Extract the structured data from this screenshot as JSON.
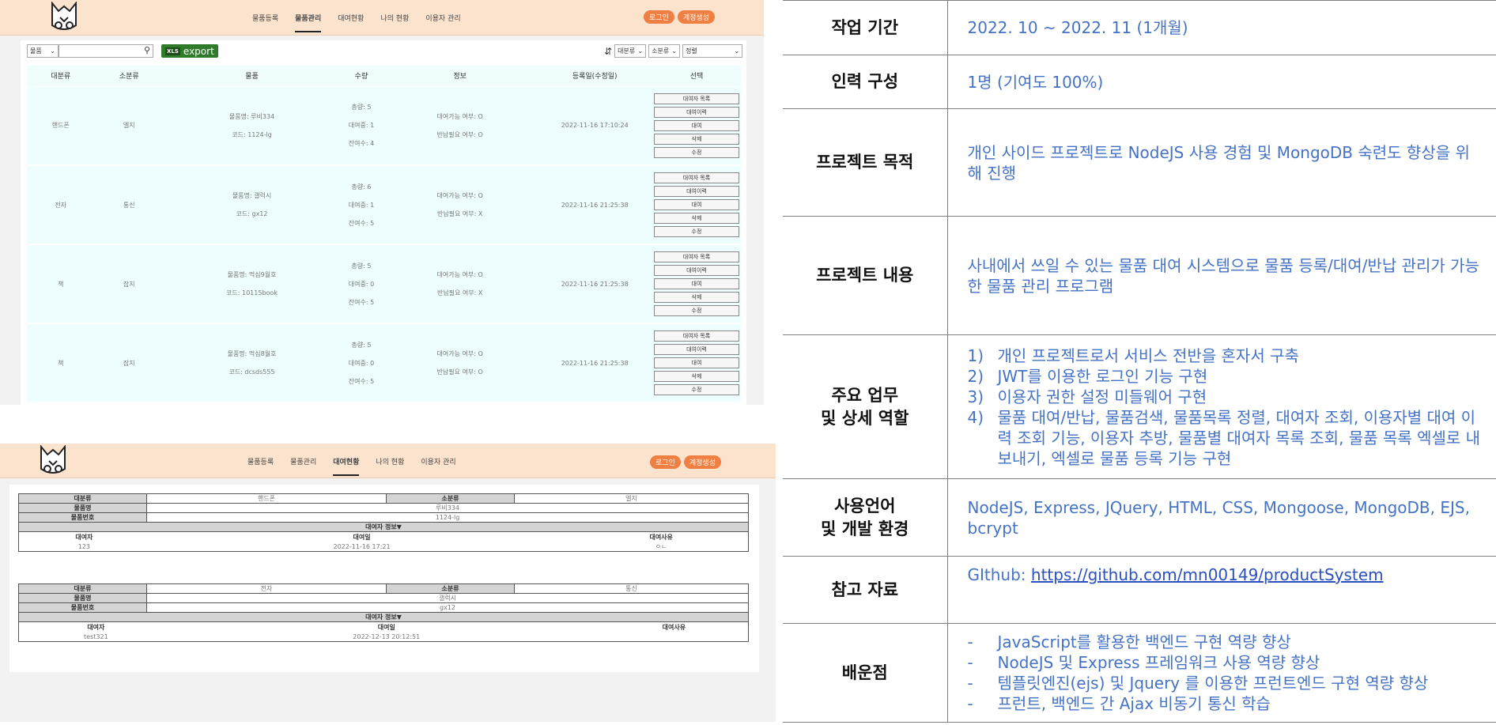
{
  "app": {
    "nav": [
      "물품등록",
      "물품관리",
      "대여현황",
      "나의 현황",
      "이용자 관리"
    ],
    "login_label": "로그인",
    "signup_label": "계정생성"
  },
  "screen1": {
    "active_tab": "물품관리",
    "search_category": "물품",
    "search_value": "",
    "export_label": "export",
    "xls_badge": "XLS",
    "filter_major": "대분류",
    "filter_minor": "소분류",
    "sort_label": "정렬",
    "columns": [
      "대분류",
      "소분류",
      "물품",
      "수량",
      "정보",
      "등록일(수정일)",
      "선택"
    ],
    "rows": [
      {
        "major": "핸드폰",
        "minor": "엘지",
        "name": "물품명: 루비334",
        "code": "코드: 1124-lg",
        "total": "총량: 5",
        "renting": "대여중: 1",
        "remain": "잔여수: 4",
        "rentable": "대여가능 여부: O",
        "returnable": "반납필요 여부: O",
        "date": "2022-11-16 17:10:24"
      },
      {
        "major": "전자",
        "minor": "통신",
        "name": "물품명: 갤럭시",
        "code": "코드: gx12",
        "total": "총량: 6",
        "renting": "대여중: 1",
        "remain": "잔여수: 5",
        "rentable": "대여가능 여부: O",
        "returnable": "반납필요 여부: X",
        "date": "2022-11-16 21:25:38"
      },
      {
        "major": "책",
        "minor": "잡지",
        "name": "물품명: 먹심9월호",
        "code": "코드: 10115book",
        "total": "총량: 5",
        "renting": "대여중: 0",
        "remain": "잔여수: 5",
        "rentable": "대여가능 여부: O",
        "returnable": "반납필요 여부: X",
        "date": "2022-11-16 21:25:38"
      },
      {
        "major": "책",
        "minor": "잡지",
        "name": "물품명: 먹심8월호",
        "code": "코드: dcsds555",
        "total": "총량: 5",
        "renting": "대여중: 0",
        "remain": "잔여수: 5",
        "rentable": "대여가능 여부: O",
        "returnable": "반납필요 여부: O",
        "date": "2022-11-16 21:25:38"
      }
    ],
    "row_buttons": [
      "대여자 목록",
      "대여이력",
      "대여",
      "삭제",
      "수정"
    ]
  },
  "screen2": {
    "active_tab": "대여현황",
    "labels": {
      "major": "대분류",
      "minor": "소분류",
      "name": "물품명",
      "code": "물품번호",
      "rent_info": "대여자 정보▼",
      "renter": "대여자",
      "rent_date": "대여일",
      "reason": "대여사유"
    },
    "records": [
      {
        "major": "핸드폰",
        "minor": "엘지",
        "name": "루비334",
        "code": "1124-lg",
        "renter": "123",
        "date": "2022-11-16 17:21",
        "reason": "ㅇㄴ"
      },
      {
        "major": "전자",
        "minor": "통신",
        "name": "갤럭시",
        "code": "gx12",
        "renter": "test321",
        "date": "2022-12-13 20:12:51",
        "reason": ""
      }
    ]
  },
  "summary": {
    "period": {
      "label": "작업 기간",
      "value": "2022. 10 ~ 2022. 11 (1개월)"
    },
    "team": {
      "label": "인력 구성",
      "value": "1명 (기여도 100%)"
    },
    "purpose": {
      "label": "프로젝트 목적",
      "value": "개인 사이드 프로젝트로 NodeJS 사용 경험 및 MongoDB 숙련도 향상을 위해 진행"
    },
    "content": {
      "label": "프로젝트 내용",
      "value": "사내에서 쓰일 수 있는 물품 대여 시스템으로 물품 등록/대여/반납 관리가 가능한 물품 관리 프로그램"
    },
    "duties": {
      "label_line1": "주요 업무",
      "label_line2": "및 상세 역할",
      "items": [
        {
          "n": "1)",
          "text": "개인 프로젝트로서 서비스 전반을 혼자서 구축"
        },
        {
          "n": "2)",
          "text": "JWT를 이용한 로그인 기능 구현"
        },
        {
          "n": "3)",
          "text": "이용자 권한 설정 미들웨어 구현"
        },
        {
          "n": "4)",
          "text": "물품 대여/반납, 물품검색, 물품목록 정렬, 대여자 조회, 이용자별 대여 이력 조회 기능, 이용자 추방, 물품별 대여자 목록 조회, 물품 목록 엑셀로 내보내기, 엑셀로 물품 등록 기능 구현"
        }
      ]
    },
    "stack": {
      "label_line1": "사용언어",
      "label_line2": "및 개발 환경",
      "value": "NodeJS, Express, JQuery, HTML, CSS, Mongoose, MongoDB, EJS, bcrypt"
    },
    "refs": {
      "label": "참고 자료",
      "prefix": "GIthub: ",
      "link": "https://github.com/mn00149/productSystem"
    },
    "learned": {
      "label": "배운점",
      "items": [
        {
          "n": "-",
          "text": "JavaScript를 활용한 백엔드 구현 역량 향상"
        },
        {
          "n": "-",
          "text": "NodeJS 및 Express 프레임워크 사용 역량 향상"
        },
        {
          "n": "-",
          "text": "템플릿엔진(ejs) 및 Jquery 를 이용한 프런트엔드 구현 역량 향상"
        },
        {
          "n": "-",
          "text": "프런트, 백엔드 간 Ajax 비동기 통신 학습"
        }
      ]
    }
  },
  "colors": {
    "accent": "#ef7f42",
    "nav_bg": "#fbe3cd",
    "text_blue": "#4472c4",
    "export_green": "#2f7b2a",
    "row_bg": "#eefdfd"
  }
}
